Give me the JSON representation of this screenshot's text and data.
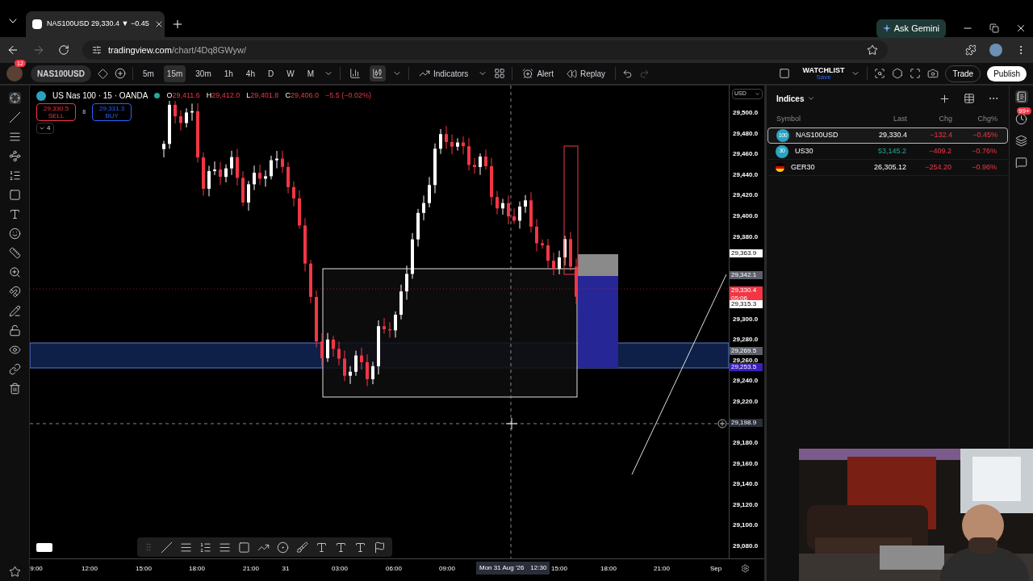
{
  "browser": {
    "tab_title": "NAS100USD 29,330.4 ▼ −0.45",
    "url_domain": "tradingview.com",
    "url_path": "/chart/4Dq8GWyw/",
    "gemini_button": "Ask Gemini"
  },
  "toolbar": {
    "avatar_badge": "12",
    "symbol": "NAS100USD",
    "intervals": [
      {
        "label": "5m",
        "selected": false
      },
      {
        "label": "15m",
        "selected": true
      },
      {
        "label": "30m",
        "selected": false
      },
      {
        "label": "1h",
        "selected": false
      },
      {
        "label": "4h",
        "selected": false
      },
      {
        "label": "D",
        "selected": false
      },
      {
        "label": "W",
        "selected": false
      },
      {
        "label": "M",
        "selected": false
      }
    ],
    "chart_types": [
      {
        "kind": "bars",
        "selected": false
      },
      {
        "kind": "candles",
        "selected": true
      }
    ],
    "indicators": "Indicators",
    "alert": "Alert",
    "replay": "Replay",
    "watchlist_title": "WATCHLIST",
    "watchlist_status": "Save",
    "trade": "Trade",
    "publish": "Publish"
  },
  "chart": {
    "title": "US Nas 100 · 15 · OANDA",
    "ohlc": [
      {
        "label": "O",
        "value": "29,411.6"
      },
      {
        "label": "H",
        "value": "29,412.0"
      },
      {
        "label": "L",
        "value": "29,401.8"
      },
      {
        "label": "C",
        "value": "29,406.0"
      }
    ],
    "change": "−5.5 (−0.02%)",
    "sell": {
      "price": "29,330.5",
      "label": "SELL"
    },
    "spread": "8",
    "buy": {
      "price": "29,331.3",
      "label": "BUY"
    },
    "indicator_count": "4"
  },
  "price_axis": {
    "currency": "USD",
    "ticks": [
      "29,500.0",
      "29,480.0",
      "29,460.0",
      "29,440.0",
      "29,420.0",
      "29,400.0",
      "29,380.0",
      "29,300.0",
      "29,280.0",
      "29,260.0",
      "29,240.0",
      "29,220.0",
      "29,180.0",
      "29,160.0",
      "29,140.0",
      "29,120.0",
      "29,100.0",
      "29,080.0"
    ],
    "tags": [
      {
        "text": "29,363.9",
        "color": "#ffffff"
      },
      {
        "text": "29,342.1",
        "color": "#5d606b"
      },
      {
        "text": "29,330.4",
        "countdown": "05:06",
        "color": "#f23645"
      },
      {
        "text": "29,315.3",
        "color": "#ffffff"
      },
      {
        "text": "29,269.5",
        "color": "#5d606b"
      },
      {
        "text": "29,253.5",
        "color": "#3c1fb8"
      },
      {
        "text": "29,198.9",
        "color": "#2a2e39"
      }
    ]
  },
  "time_axis": {
    "labels": [
      "9:00",
      "12:00",
      "15:00",
      "18:00",
      "21:00",
      "31",
      "03:00",
      "06:00",
      "09:00",
      "15:00",
      "18:00",
      "21:00",
      "Sep"
    ],
    "cursor_date": "Mon 31 Aug '26",
    "cursor_time": "12:30"
  },
  "watchlist": {
    "title": "Indices",
    "columns": [
      "Symbol",
      "Last",
      "Chg",
      "Chg%"
    ],
    "rows": [
      {
        "symbol": "NAS100USD",
        "kind": "badge",
        "badge": "100",
        "last": "29,330.4",
        "rising": false,
        "chg": "−132.4",
        "chg_pct": "−0.45%",
        "selected": true
      },
      {
        "symbol": "US30",
        "kind": "badge",
        "badge": "30",
        "last": "53,145.2",
        "rising": true,
        "chg": "−409.2",
        "chg_pct": "−0.76%",
        "selected": false
      },
      {
        "symbol": "GER30",
        "kind": "flag",
        "last": "26,305.12",
        "rising": false,
        "chg": "−254.20",
        "chg_pct": "−0.96%",
        "selected": false
      }
    ]
  },
  "side_panel": {
    "notification_badge": "99+"
  }
}
